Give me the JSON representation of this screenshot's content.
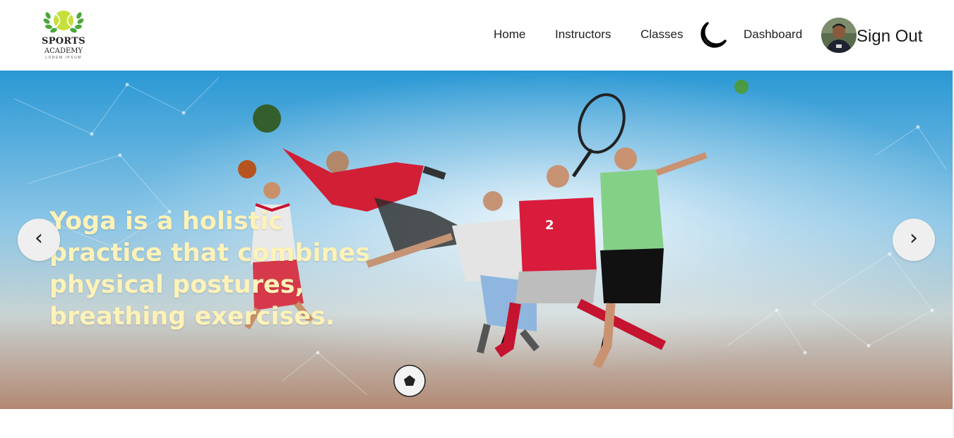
{
  "brand": {
    "line1": "SPORTS",
    "line2": "ACADEMY",
    "line3": "LOREM IPSUM",
    "ball_color": "#c6e03a",
    "laurel_color": "#4aa83a"
  },
  "nav": {
    "home": "Home",
    "instructors": "Instructors",
    "classes": "Classes",
    "dashboard": "Dashboard",
    "sign_out": "Sign Out",
    "theme_icon": "moon-icon"
  },
  "hero": {
    "caption": "Yoga is a holistic practice that combines physical postures, breathing exercises.",
    "caption_color": "#fdf2b8",
    "prev_label": "‹",
    "next_label": "›",
    "sky_top": "#2a98d4",
    "ground": "#b38872"
  },
  "colors": {
    "nav_text": "#1f1f1f",
    "background": "#ffffff"
  }
}
